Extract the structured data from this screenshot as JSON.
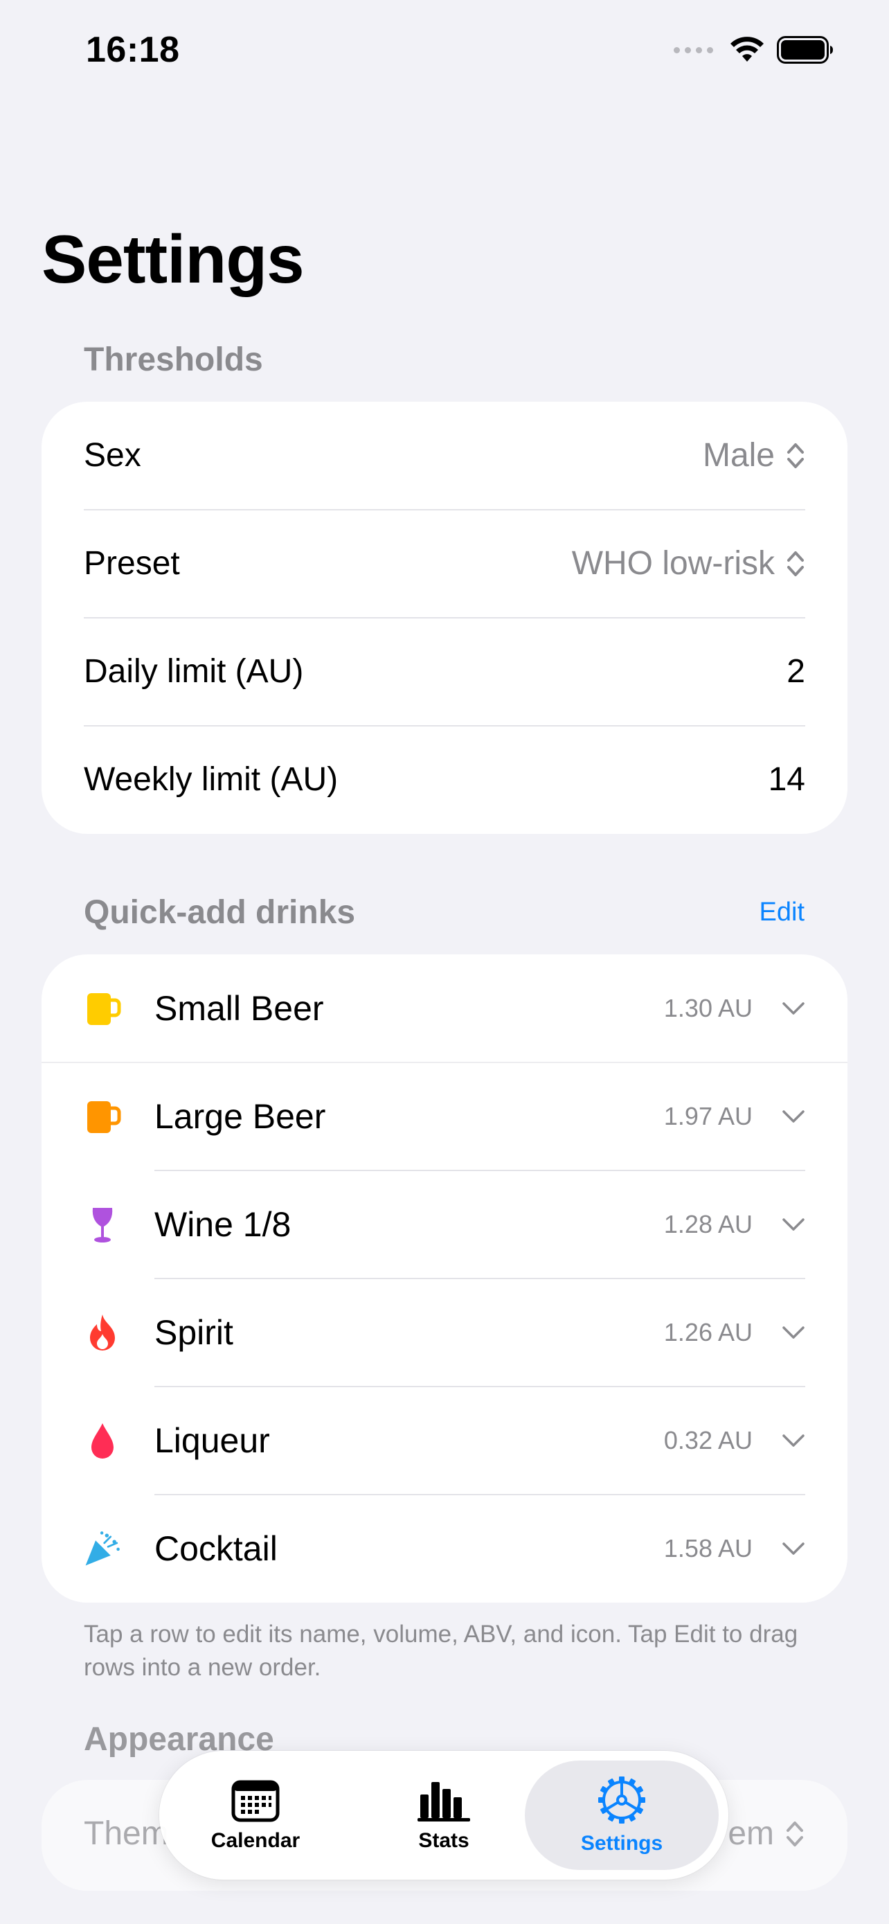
{
  "status_bar": {
    "time": "16:18"
  },
  "page_title": "Settings",
  "thresholds": {
    "header": "Thresholds",
    "rows": [
      {
        "label": "Sex",
        "value": "Male"
      },
      {
        "label": "Preset",
        "value": "WHO low-risk"
      },
      {
        "label": "Daily limit (AU)",
        "value": "2"
      },
      {
        "label": "Weekly limit (AU)",
        "value": "14"
      }
    ]
  },
  "quick_add": {
    "header": "Quick-add drinks",
    "edit_label": "Edit",
    "drinks": [
      {
        "name": "Small Beer",
        "au": "1.30 AU",
        "icon": "mug-icon",
        "color": "#ffcc00"
      },
      {
        "name": "Large Beer",
        "au": "1.97 AU",
        "icon": "mug-icon",
        "color": "#ff9500"
      },
      {
        "name": "Wine 1/8",
        "au": "1.28 AU",
        "icon": "wineglass-icon",
        "color": "#af52de"
      },
      {
        "name": "Spirit",
        "au": "1.26 AU",
        "icon": "flame-icon",
        "color": "#ff3b30"
      },
      {
        "name": "Liqueur",
        "au": "0.32 AU",
        "icon": "drop-icon",
        "color": "#ff2d55"
      },
      {
        "name": "Cocktail",
        "au": "1.58 AU",
        "icon": "party-popper-icon",
        "color": "#32ade6"
      }
    ],
    "footnote": "Tap a row to edit its name, volume, ABV, and icon. Tap Edit to drag rows into a new order."
  },
  "appearance": {
    "header": "Appearance",
    "row_label_partial": "Them",
    "row_value_partial": "em"
  },
  "tabbar": {
    "tabs": [
      {
        "label": "Calendar",
        "icon": "calendar-icon"
      },
      {
        "label": "Stats",
        "icon": "chart-bar-icon"
      },
      {
        "label": "Settings",
        "icon": "gear-icon",
        "active": true
      }
    ],
    "accent": "#0a84ff"
  }
}
